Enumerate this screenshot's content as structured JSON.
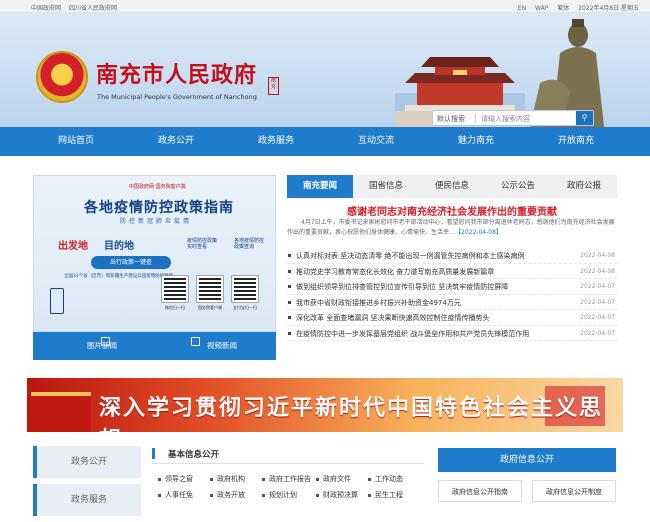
{
  "topbar": {
    "left": [
      "中国政府网",
      "四川省人民政府网"
    ],
    "right": [
      "EN",
      "WAP",
      "繁体",
      "2022年4月8日 星期五"
    ]
  },
  "header": {
    "title": "南充市人民政府",
    "subtitle": "The Municipal People's Government of Nanchong",
    "seal": "南充",
    "search": {
      "scope": "默认搜索",
      "placeholder": "请输入搜索内容"
    }
  },
  "nav": [
    "网站首页",
    "政务公开",
    "政务服务",
    "互动交流",
    "魅力南充",
    "开放南充"
  ],
  "slide": {
    "brand": "中国政府网  国务院客户端",
    "title": "各地疫情防控政策指南",
    "subtitle": "防控新冠肺炎疫情",
    "from": "出发地",
    "to": "目的地",
    "tag": "出行政策一键查",
    "hotline": "全国31个省（区市）和新疆生产建设兵团疫情防控政策",
    "side_lines": [
      "疫情防控政策",
      "实时查看",
      "各地疫情防控",
      "政策查询"
    ],
    "qr_labels": [
      "微信扫一扫",
      "国务院客户端",
      "支付宝扫一扫"
    ]
  },
  "media": {
    "pic_news": "图片新闻",
    "video_news": "视频新闻"
  },
  "tabs": [
    "南充要闻",
    "国省信息",
    "便民信息",
    "公示公告",
    "政府公报"
  ],
  "headline": "感谢老同志对南充经济社会发展作出的重要贡献",
  "summary": "4月7日上午，市委书记来家彬慰问市老干部活动中心，看望慰问我市部分离退休老同志，感谢他们为南充经济社会发展作出的重要贡献，衷心祝愿他们身体健康、心情愉快、生活幸…",
  "summary_more": "【2022-04-08】",
  "news": [
    {
      "title": "认真对标对表 坚决动态清零 绝不能出现一例漏管失控病例和本土感染病例",
      "date": "2022-04-08"
    },
    {
      "title": "推动党史学习教育常态化长效化 奋力谱写南充高质量发展新篇章",
      "date": "2022-04-08"
    },
    {
      "title": "做到组织领导到位排查管控到位宣传引导到位 坚决筑牢疫情防控屏障",
      "date": "2022-04-07"
    },
    {
      "title": "我市获中省财政衔接推进乡村振兴补助资金4974万元",
      "date": "2022-04-07"
    },
    {
      "title": "深化改革 全面查堵漏洞 坚决果断快速高效控制住疫情传播势头",
      "date": "2022-04-07"
    },
    {
      "title": "在疫情防控中进一步发挥基层党组织 战斗堡垒作用和共产党员先锋模范作用",
      "date": "2022-04-07"
    }
  ],
  "banner": "深入学习贯彻习近平新时代中国特色社会主义思想",
  "leftmenu": [
    "政务公开",
    "政务服务"
  ],
  "basic_info": {
    "title": "基本信息公开",
    "items": [
      "领导之窗",
      "政府机构",
      "政府工作报告",
      "政府文件",
      "工作动态",
      "人事任免",
      "政务开放",
      "规划计划",
      "财政预决算",
      "民生工程"
    ]
  },
  "govinfo": {
    "title": "政府信息公开",
    "buttons": [
      "政府信息公开指南",
      "政府信息公开制度"
    ]
  },
  "colors": {
    "accent": "#1f7ccc",
    "red": "#d4202a"
  }
}
